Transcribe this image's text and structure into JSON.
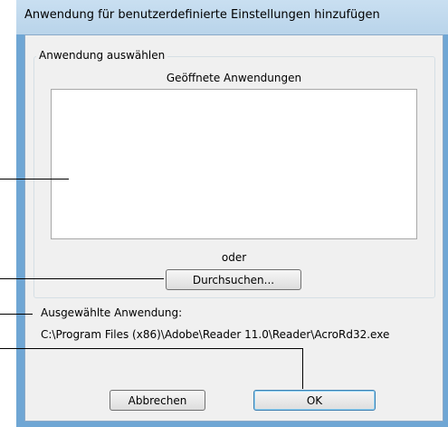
{
  "window": {
    "title": "Anwendung für benutzerdefinierte Einstellungen hinzufügen"
  },
  "group": {
    "legend": "Anwendung auswählen",
    "list_caption": "Geöffnete Anwendungen",
    "or_text": "oder",
    "browse_label": "Durchsuchen..."
  },
  "selected": {
    "label": "Ausgewählte Anwendung:",
    "path": "C:\\Program Files (x86)\\Adobe\\Reader 11.0\\Reader\\AcroRd32.exe"
  },
  "buttons": {
    "cancel_label": "Abbrechen",
    "ok_label": "OK"
  }
}
